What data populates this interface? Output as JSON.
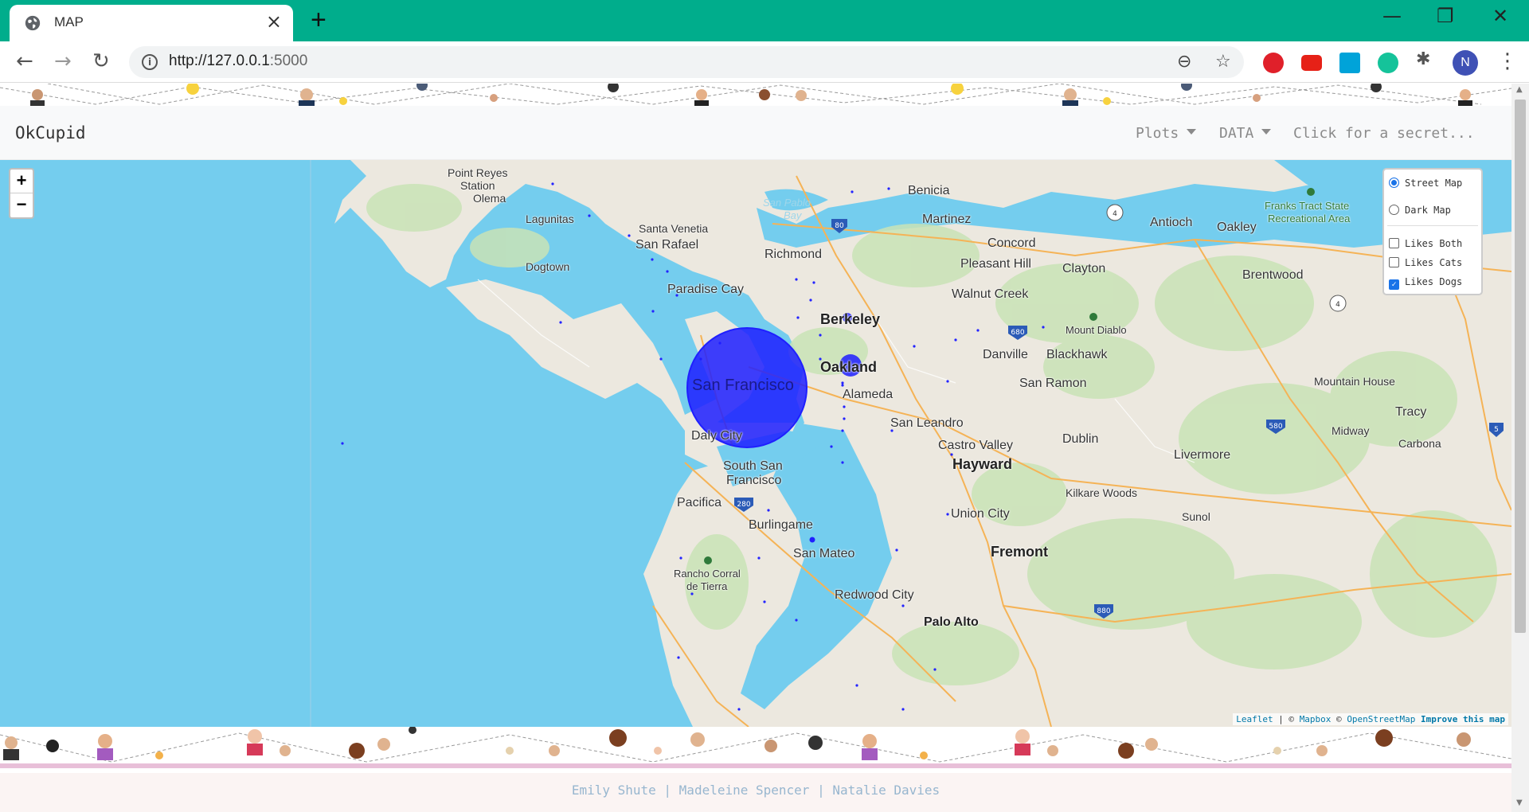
{
  "browser": {
    "tab_title": "MAP",
    "tab_close": "×",
    "new_tab": "+",
    "url_host": "http://127.0.0.1",
    "url_port": ":5000",
    "profile_initial": "N",
    "window_controls": [
      "—",
      "❐",
      "✕"
    ],
    "icons": [
      "back-icon",
      "forward-icon",
      "reload-icon",
      "info-icon",
      "zoom-out-icon",
      "star-icon",
      "extensions-icon",
      "menu-icon"
    ]
  },
  "navbar": {
    "brand": "OkCupid",
    "plots": "Plots",
    "data": "DATA",
    "secret": "Click for a secret..."
  },
  "map": {
    "zoom_in": "+",
    "zoom_out": "−",
    "layers": {
      "base": [
        {
          "label": "Street Map",
          "checked": true
        },
        {
          "label": "Dark Map",
          "checked": false
        }
      ],
      "overlays": [
        {
          "label": "Likes Both",
          "checked": false
        },
        {
          "label": "Likes Cats",
          "checked": false
        },
        {
          "label": "Likes Dogs",
          "checked": true
        }
      ]
    },
    "attribution": {
      "leaflet": "Leaflet",
      "sep": " | © ",
      "mapbox": "Mapbox",
      "osm_prefix": " © ",
      "osm": "OpenStreetMap",
      "improve": " Improve this map"
    },
    "places": [
      "Point Reyes",
      "Station",
      "Olema",
      "Lagunitas",
      "Santa Venetia",
      "San Rafael",
      "Dogtown",
      "Paradise Cay",
      "San Pablo",
      "Bay",
      "Richmond",
      "Benicia",
      "Martinez",
      "Concord",
      "Pleasant Hill",
      "Clayton",
      "Walnut Creek",
      "Antioch",
      "Oakley",
      "Brentwood",
      "Franks Tract State",
      "Recreational Area",
      "Berkeley",
      "Oakland",
      "Alameda",
      "San Francisco",
      "Mount Diablo",
      "Danville",
      "Blackhawk",
      "San Ramon",
      "Mountain House",
      "San Leandro",
      "Castro Valley",
      "Hayward",
      "Dublin",
      "Livermore",
      "Tracy",
      "Midway",
      "Carbona",
      "Daly City",
      "South San",
      "Francisco",
      "Pacifica",
      "Burlingame",
      "San Mateo",
      "Kilkare Woods",
      "Sunol",
      "Union City",
      "Fremont",
      "Rancho Corral",
      "de Tierra",
      "Redwood City",
      "Palo Alto"
    ],
    "circle_markers": [
      {
        "name": "San Francisco",
        "size_rank": "large"
      },
      {
        "name": "Oakland",
        "size_rank": "medium"
      },
      {
        "name": "Berkeley",
        "size_rank": "small"
      },
      {
        "name": "San Mateo",
        "size_rank": "small"
      }
    ],
    "highway_shields": [
      "80",
      "4",
      "680",
      "580",
      "5",
      "280",
      "880",
      "4"
    ]
  },
  "footer": {
    "credits": "Emily Shute | Madeleine Spencer | Natalie Davies"
  },
  "colors": {
    "chrome_teal": "#00ad8c",
    "water": "#74cdee",
    "land": "#ece8df",
    "marker": "#1f1fff"
  }
}
